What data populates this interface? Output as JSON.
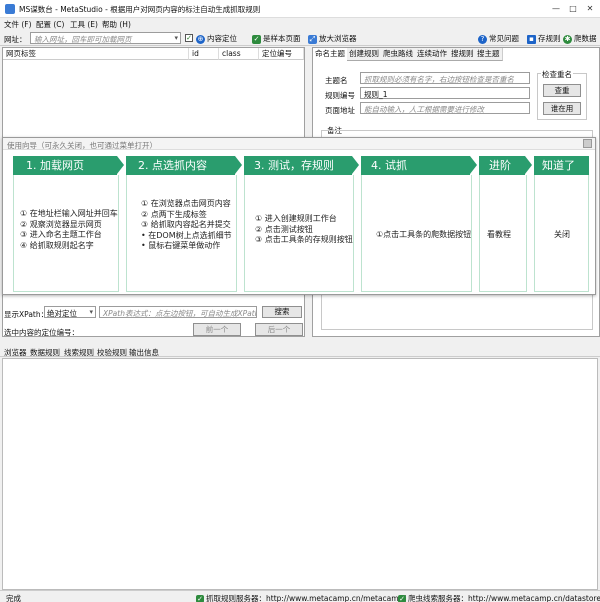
{
  "window": {
    "title": "MS谋数台 - MetaStudio - 根据用户对网页内容的标注自动生成抓取规则",
    "controls": [
      "—",
      "□",
      "✕"
    ]
  },
  "menu": [
    "文件 (F)",
    "配置 (C)",
    "工具 (E)",
    "帮助 (H)"
  ],
  "toolbar": {
    "address_label": "网址：",
    "address_placeholder": "输入网址，回车即可加载网页",
    "locate_label": "内容定位",
    "sample_label": "是样本页面",
    "zoom_browser_label": "放大浏览器",
    "faq_label": "常见问题",
    "save_rule_label": "存规则",
    "crawler_label": "爬数据"
  },
  "left_panel": {
    "columns": [
      "网页标签",
      "id",
      "class",
      "定位编号"
    ]
  },
  "right_panel": {
    "tabs": [
      "命名主题",
      "创建规则",
      "爬虫路线",
      "连续动作",
      "搜规则",
      "搜主题"
    ],
    "active_tab": 0,
    "theme_name_label": "主题名",
    "theme_name_placeholder": "抓取规则必须有名字，右边按钮检查是否重名",
    "check_group_label": "检查重名",
    "query_button": "查重",
    "rule_no_label": "规则编号",
    "rule_no_value": "规则_1",
    "page_addr_label": "页面地址",
    "page_addr_placeholder": "能自动输入，人工根据需要进行修改",
    "use_button": "谁在用",
    "remark_label": "备注"
  },
  "guide": {
    "note": "使用向导（可永久关闭，也可通过菜单打开）",
    "steps": [
      {
        "title": "1. 加载网页",
        "lines": [
          "① 在地址栏输入网址并回车",
          "② 观察浏览器显示网页",
          "③ 进入命名主题工作台",
          "④ 给抓取规则起名字"
        ]
      },
      {
        "title": "2. 点选抓内容",
        "lines": [
          "① 在浏览器点击网页内容",
          "② 点两下生成标签",
          "③ 给抓取内容起名并提交",
          "• 在DOM树上点选抓细节",
          "• 鼠标右键菜单做动作"
        ]
      },
      {
        "title": "3. 测试，存规则",
        "lines": [
          "① 进入创建规则工作台",
          "② 点击测试按钮",
          "③ 点击工具条的存规则按钮"
        ]
      },
      {
        "title": "4. 试抓",
        "lines": [
          "①点击工具条的爬数据按钮"
        ]
      },
      {
        "title": "进阶",
        "lines": [
          "看教程"
        ]
      },
      {
        "title": "知道了",
        "lines": [
          "关闭"
        ]
      }
    ]
  },
  "xpath": {
    "show_label": "显示XPath：",
    "mode_value": "绝对定位",
    "expr_placeholder": "XPath表达式：点左边按钮，可自动生成XPath，",
    "search_button": "搜索",
    "selected_label": "选中内容的定位编号：",
    "prev_button": "前一个",
    "next_button": "后一个"
  },
  "bottom_tabs": [
    "浏览器",
    "数据规则",
    "线索规则",
    "校验规则",
    "输出信息"
  ],
  "status": {
    "left": "完成",
    "rule_server": "抓取规则服务器：http://www.metacamp.cn/metacamp/",
    "clue_server": "爬虫线索服务器：http://www.metacamp.cn/datastore/"
  },
  "colors": {
    "guide_green": "#2a9d6e",
    "icon_green": "#2e8b3e",
    "icon_blue": "#1d64c8"
  }
}
